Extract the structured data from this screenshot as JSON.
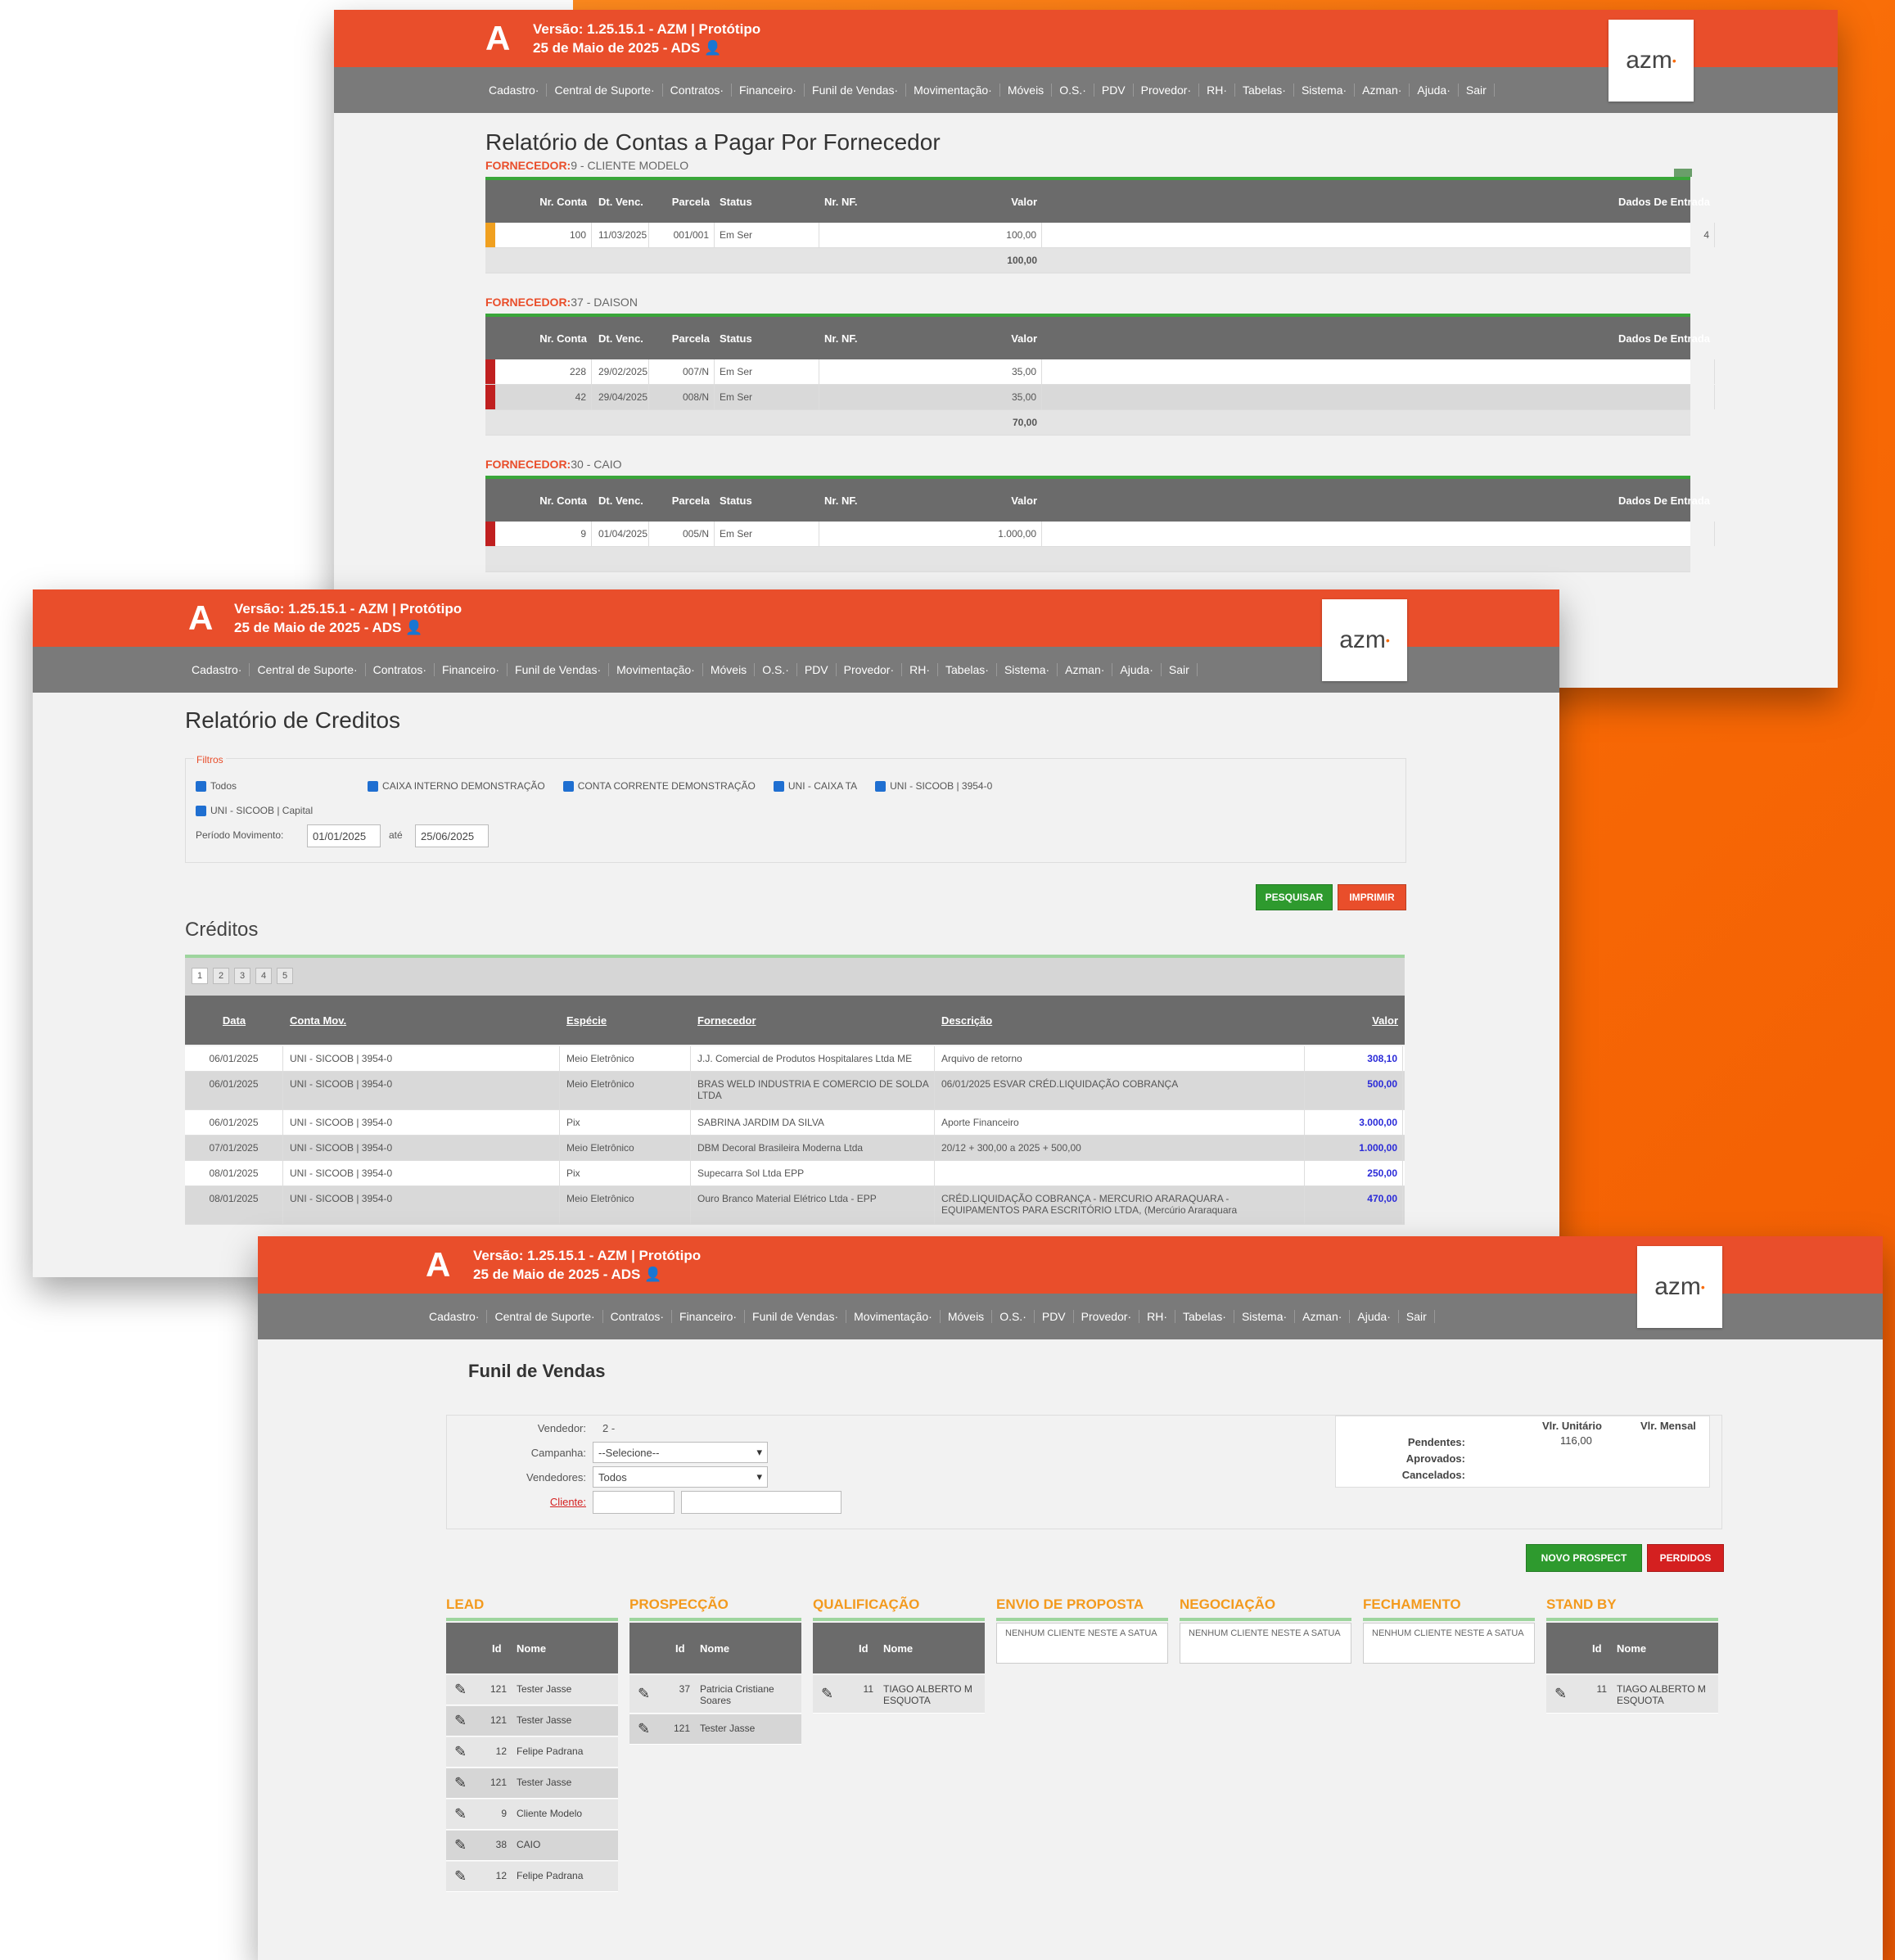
{
  "header": {
    "version_line": "Versão: 1.25.15.1 - AZM | Protótipo",
    "date_line": "25 de Maio de 2025 - ADS",
    "logo_a": "A",
    "azm_logo": "azm"
  },
  "menu": [
    "Cadastro·",
    "Central de Suporte·",
    "Contratos·",
    "Financeiro·",
    "Funil de Vendas·",
    "Movimentação·",
    "Móveis",
    "O.S.·",
    "PDV",
    "Provedor·",
    "RH·",
    "Tabelas·",
    "Sistema·",
    "Azman·",
    "Ajuda·",
    "Sair"
  ],
  "window1": {
    "title": "Relatório de Contas a Pagar Por Fornecedor",
    "columns": [
      "Nr. Conta",
      "Dt. Venc.",
      "Parcela",
      "Status",
      "Nr. NF.",
      "Valor",
      "Dados De Entrada"
    ],
    "groups": [
      {
        "label": "FORNECEDOR:",
        "name": "9 - CLIENTE MODELO",
        "rows": [
          {
            "conta": "100",
            "venc": "11/03/2025",
            "parcela": "001/001",
            "status": "Em Ser",
            "valor": "100,00",
            "entrada": "4",
            "color": "#f0a020"
          }
        ],
        "total": "100,00"
      },
      {
        "label": "FORNECEDOR:",
        "name": "37 - DAISON",
        "rows": [
          {
            "conta": "228",
            "venc": "29/02/2025",
            "parcela": "007/N",
            "status": "Em Ser",
            "valor": "35,00",
            "entrada": "",
            "color": "#c02020"
          },
          {
            "conta": "42",
            "venc": "29/04/2025",
            "parcela": "008/N",
            "status": "Em Ser",
            "valor": "35,00",
            "entrada": "",
            "color": "#c02020"
          }
        ],
        "total": "70,00"
      },
      {
        "label": "FORNECEDOR:",
        "name": "30 - CAIO",
        "rows": [
          {
            "conta": "9",
            "venc": "01/04/2025",
            "parcela": "005/N",
            "status": "Em Ser",
            "valor": "1.000,00",
            "entrada": "",
            "color": "#c02020"
          }
        ],
        "total": ""
      }
    ]
  },
  "window2": {
    "title": "Relatório de Creditos",
    "filters_label": "Filtros",
    "checkboxes": [
      "Todos",
      "CAIXA INTERNO DEMONSTRAÇÃO",
      "CONTA CORRENTE DEMONSTRAÇÃO",
      "UNI - CAIXA TA",
      "UNI - SICOOB | 3954-0",
      "UNI - SICOOB | Capital"
    ],
    "period_label": "Período Movimento:",
    "date_from": "01/01/2025",
    "date_sep": "até",
    "date_to": "25/06/2025",
    "btn_search": "PESQUISAR",
    "btn_print": "IMPRIMIR",
    "section": "Créditos",
    "pages": [
      "1",
      "2",
      "3",
      "4",
      "5"
    ],
    "columns": [
      "Data",
      "Conta Mov.",
      "Espécie",
      "Fornecedor",
      "Descrição",
      "Valor"
    ],
    "rows": [
      {
        "data": "06/01/2025",
        "conta": "UNI - SICOOB | 3954-0",
        "especie": "Meio Eletrônico",
        "fornecedor": "J.J. Comercial de Produtos Hospitalares Ltda ME",
        "descricao": "Arquivo de retorno",
        "valor": "308,10"
      },
      {
        "data": "06/01/2025",
        "conta": "UNI - SICOOB | 3954-0",
        "especie": "Meio Eletrônico",
        "fornecedor": "BRAS WELD INDUSTRIA E COMERCIO DE SOLDA LTDA",
        "descricao": "06/01/2025 ESVAR CRÉD.LIQUIDAÇÃO COBRANÇA",
        "valor": "500,00"
      },
      {
        "data": "06/01/2025",
        "conta": "UNI - SICOOB | 3954-0",
        "especie": "Pix",
        "fornecedor": "SABRINA JARDIM DA SILVA",
        "descricao": "Aporte Financeiro",
        "valor": "3.000,00"
      },
      {
        "data": "07/01/2025",
        "conta": "UNI - SICOOB | 3954-0",
        "especie": "Meio Eletrônico",
        "fornecedor": "DBM Decoral Brasileira Moderna Ltda",
        "descricao": "20/12 + 300,00 a 2025 + 500,00",
        "valor": "1.000,00"
      },
      {
        "data": "08/01/2025",
        "conta": "UNI - SICOOB | 3954-0",
        "especie": "Pix",
        "fornecedor": "Supecarra Sol Ltda EPP",
        "descricao": "",
        "valor": "250,00"
      },
      {
        "data": "08/01/2025",
        "conta": "UNI - SICOOB | 3954-0",
        "especie": "Meio Eletrônico",
        "fornecedor": "Ouro Branco Material Elétrico Ltda - EPP",
        "descricao": "CRÉD.LIQUIDAÇÃO COBRANÇA - MERCURIO ARARAQUARA - EQUIPAMENTOS PARA ESCRITÓRIO LTDA, (Mercúrio Araraquara",
        "valor": "470,00"
      }
    ]
  },
  "window3": {
    "title": "Funil de Vendas",
    "vendedor_label": "Vendedor:",
    "vendedor_value": "2 -",
    "campanha_label": "Campanha:",
    "campanha_value": "--Selecione--",
    "vendedores_label": "Vendedores:",
    "vendedores_value": "Todos",
    "cliente_label": "Cliente:",
    "summary": {
      "col1": "Vlr. Unitário",
      "col2": "Vlr. Mensal",
      "rows": [
        "Pendentes:",
        "Aprovados:",
        "Cancelados:"
      ],
      "pend_val": "116,00"
    },
    "btn_new": "NOVO PROSPECT",
    "btn_lost": "PERDIDOS",
    "id_head": "Id",
    "name_head": "Nome",
    "empty_text": "NENHUM CLIENTE NESTE A SATUA",
    "columns": [
      {
        "title": "LEAD",
        "cards": [
          [
            "121",
            "Tester Jasse"
          ],
          [
            "121",
            "Tester Jasse"
          ],
          [
            "12",
            "Felipe Padrana"
          ],
          [
            "121",
            "Tester Jasse"
          ],
          [
            "9",
            "Cliente Modelo"
          ],
          [
            "38",
            "CAIO"
          ],
          [
            "12",
            "Felipe Padrana"
          ]
        ]
      },
      {
        "title": "PROSPECÇÃO",
        "cards": [
          [
            "37",
            "Patricia Cristiane Soares"
          ],
          [
            "121",
            "Tester Jasse"
          ]
        ]
      },
      {
        "title": "QUALIFICAÇÃO",
        "cards": [
          [
            "11",
            "TIAGO ALBERTO M ESQUOTA"
          ]
        ]
      },
      {
        "title": "ENVIO DE PROPOSTA",
        "cards": []
      },
      {
        "title": "NEGOCIAÇÃO",
        "cards": []
      },
      {
        "title": "FECHAMENTO",
        "cards": []
      },
      {
        "title": "STAND BY",
        "cards": [
          [
            "11",
            "TIAGO ALBERTO M ESQUOTA"
          ]
        ]
      }
    ]
  },
  "colors": {
    "topbar": "#e94e2b",
    "menubar": "#7a7a7a",
    "accent_orange": "#f86a05",
    "green": "#2e9a2e",
    "red": "#d42020"
  }
}
